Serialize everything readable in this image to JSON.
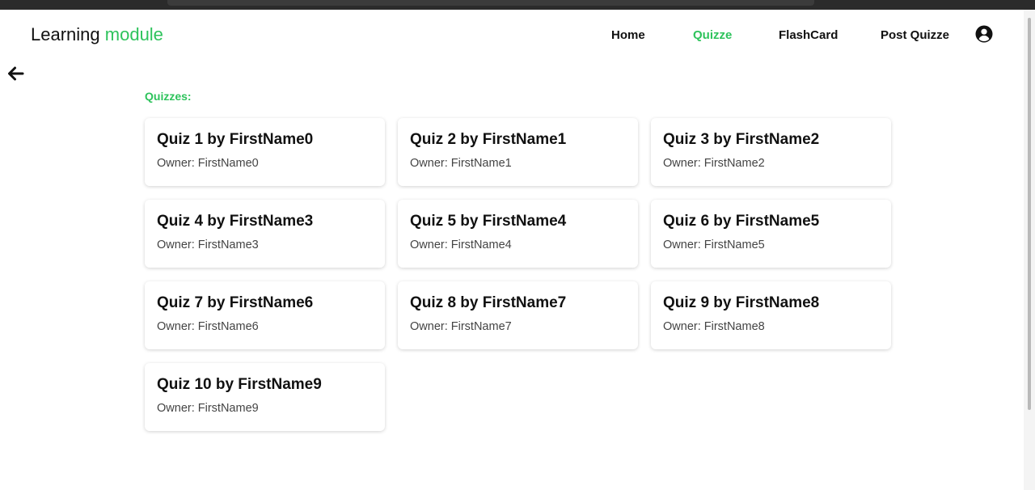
{
  "brand": {
    "name": "Learning",
    "accent": "module"
  },
  "nav": {
    "items": [
      {
        "label": "Home"
      },
      {
        "label": "Quizze"
      },
      {
        "label": "FlashCard"
      },
      {
        "label": "Post Quizze"
      }
    ],
    "active": "Quizze"
  },
  "icons": {
    "back": "arrow-left-icon",
    "user": "user-circle-icon"
  },
  "colors": {
    "accent": "#2ec35c",
    "text": "#111111",
    "muted": "#444444"
  },
  "section": {
    "title": "Quizzes:"
  },
  "quizzes": [
    {
      "title": "Quiz 1 by FirstName0",
      "owner": "Owner: FirstName0"
    },
    {
      "title": "Quiz 2 by FirstName1",
      "owner": "Owner: FirstName1"
    },
    {
      "title": "Quiz 3 by FirstName2",
      "owner": "Owner: FirstName2"
    },
    {
      "title": "Quiz 4 by FirstName3",
      "owner": "Owner: FirstName3"
    },
    {
      "title": "Quiz 5 by FirstName4",
      "owner": "Owner: FirstName4"
    },
    {
      "title": "Quiz 6 by FirstName5",
      "owner": "Owner: FirstName5"
    },
    {
      "title": "Quiz 7 by FirstName6",
      "owner": "Owner: FirstName6"
    },
    {
      "title": "Quiz 8 by FirstName7",
      "owner": "Owner: FirstName7"
    },
    {
      "title": "Quiz 9 by FirstName8",
      "owner": "Owner: FirstName8"
    },
    {
      "title": "Quiz 10 by FirstName9",
      "owner": "Owner: FirstName9"
    }
  ]
}
